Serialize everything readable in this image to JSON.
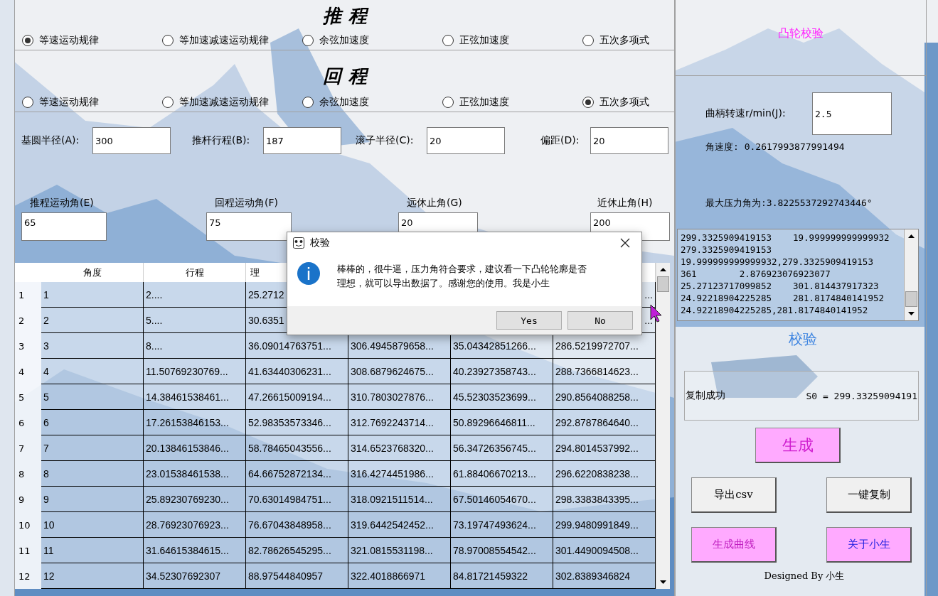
{
  "left": {
    "sections": [
      {
        "title": "推程",
        "options": [
          {
            "label": "等速运动规律",
            "selected": true
          },
          {
            "label": "等加速减速运动规律",
            "selected": false
          },
          {
            "label": "余弦加速度",
            "selected": false
          },
          {
            "label": "正弦加速度",
            "selected": false
          },
          {
            "label": "五次多项式",
            "selected": false
          }
        ]
      },
      {
        "title": "回程",
        "options": [
          {
            "label": "等速运动规律",
            "selected": false
          },
          {
            "label": "等加速减速运动规律",
            "selected": false
          },
          {
            "label": "余弦加速度",
            "selected": false
          },
          {
            "label": "正弦加速度",
            "selected": false
          },
          {
            "label": "五次多项式",
            "selected": true
          }
        ]
      }
    ],
    "params_row1": [
      {
        "label": "基圆半径(A):",
        "value": "300"
      },
      {
        "label": "推杆行程(B):",
        "value": "187"
      },
      {
        "label": "滚子半径(C):",
        "value": "20"
      },
      {
        "label": "偏距(D):",
        "value": "20"
      }
    ],
    "params_row2": [
      {
        "label": "推程运动角(E)",
        "value": "65"
      },
      {
        "label": "回程运动角(F)",
        "value": "75"
      },
      {
        "label": "远休止角(G)",
        "value": "20"
      },
      {
        "label": "近休止角(H)",
        "value": "200"
      }
    ],
    "table": {
      "columns": [
        "角度",
        "行程",
        "理"
      ],
      "rows": [
        {
          "header": "1",
          "cells": [
            "1",
            "2....",
            "25.2712"
          ],
          "tail": "..."
        },
        {
          "header": "2",
          "cells": [
            "2",
            "5....",
            "30.6351"
          ],
          "tail": "..."
        },
        {
          "header": "3",
          "cells": [
            "3",
            "8....",
            "36.09014763751...",
            "306.4945879658...",
            "35.04342851266...",
            "286.5219972707..."
          ]
        },
        {
          "header": "4",
          "cells": [
            "4",
            "11.50769230769...",
            "41.63440306231...",
            "308.6879624675...",
            "40.23927358743...",
            "288.7366814623..."
          ]
        },
        {
          "header": "5",
          "cells": [
            "5",
            "14.38461538461...",
            "47.26615009194...",
            "310.7803027876...",
            "45.52303523699...",
            "290.8564088258..."
          ]
        },
        {
          "header": "6",
          "cells": [
            "6",
            "17.26153846153...",
            "52.98353573346...",
            "312.7692243714...",
            "50.89296646811...",
            "292.8787864640..."
          ]
        },
        {
          "header": "7",
          "cells": [
            "7",
            "20.13846153846...",
            "58.78465043556...",
            "314.6523768320...",
            "56.34726356745...",
            "294.8014537992..."
          ]
        },
        {
          "header": "8",
          "cells": [
            "8",
            "23.01538461538...",
            "64.66752872134...",
            "316.4274451986...",
            "61.88406670213...",
            "296.6220838238..."
          ]
        },
        {
          "header": "9",
          "cells": [
            "9",
            "25.89230769230...",
            "70.63014984751...",
            "318.0921511514...",
            "67.50146054670...",
            "298.3383843395..."
          ]
        },
        {
          "header": "10",
          "cells": [
            "10",
            "28.76923076923...",
            "76.67043848958...",
            "319.6442542452...",
            "73.19747493624...",
            "299.9480991849..."
          ]
        },
        {
          "header": "11",
          "cells": [
            "11",
            "31.64615384615...",
            "82.78626545295...",
            "321.0815531198...",
            "78.97008554542...",
            "301.4490094508..."
          ]
        },
        {
          "header": "12",
          "cells": [
            "12",
            "34.52307692307",
            "88.97544840957",
            "322.4018866971",
            "84.81721459322",
            "302.8389346824"
          ]
        }
      ]
    }
  },
  "right": {
    "title": "凸轮校验",
    "speed": {
      "label": "曲柄转速r/min(J):",
      "value": "2.5"
    },
    "angular_velocity": "角速度: 0.2617993877991494",
    "max_pressure_angle": "最大压力角为:3.8225537292743446°",
    "output_lines": [
      "299.3325909419153    19.999999999999932",
      "279.3325909419153",
      "19.999999999999932,279.3325909419153",
      "361        2.876923076923077",
      "25.27123717099852    301.814437917323",
      "24.92218904225285    281.8174840141952",
      "24.92218904225285,281.8174840141952"
    ],
    "check_title": "校验",
    "status": {
      "message": "复制成功",
      "result": "S0 = 299.33259094191"
    },
    "buttons": [
      {
        "label": "生成",
        "kind": "generate"
      },
      {
        "label": "导出csv",
        "kind": "plain"
      },
      {
        "label": "一键复制",
        "kind": "plain"
      },
      {
        "label": "生成曲线",
        "kind": "accent"
      },
      {
        "label": "关于小生",
        "kind": "info"
      }
    ],
    "footer": "Designed By 小生"
  },
  "dialog": {
    "title": "校验",
    "message": "棒棒的，很牛逼，压力角符合要求，建议看一下凸轮轮廓是否理想，就可以导出数据了。感谢您的使用。我是小生",
    "buttons": [
      "Yes",
      "No"
    ]
  }
}
